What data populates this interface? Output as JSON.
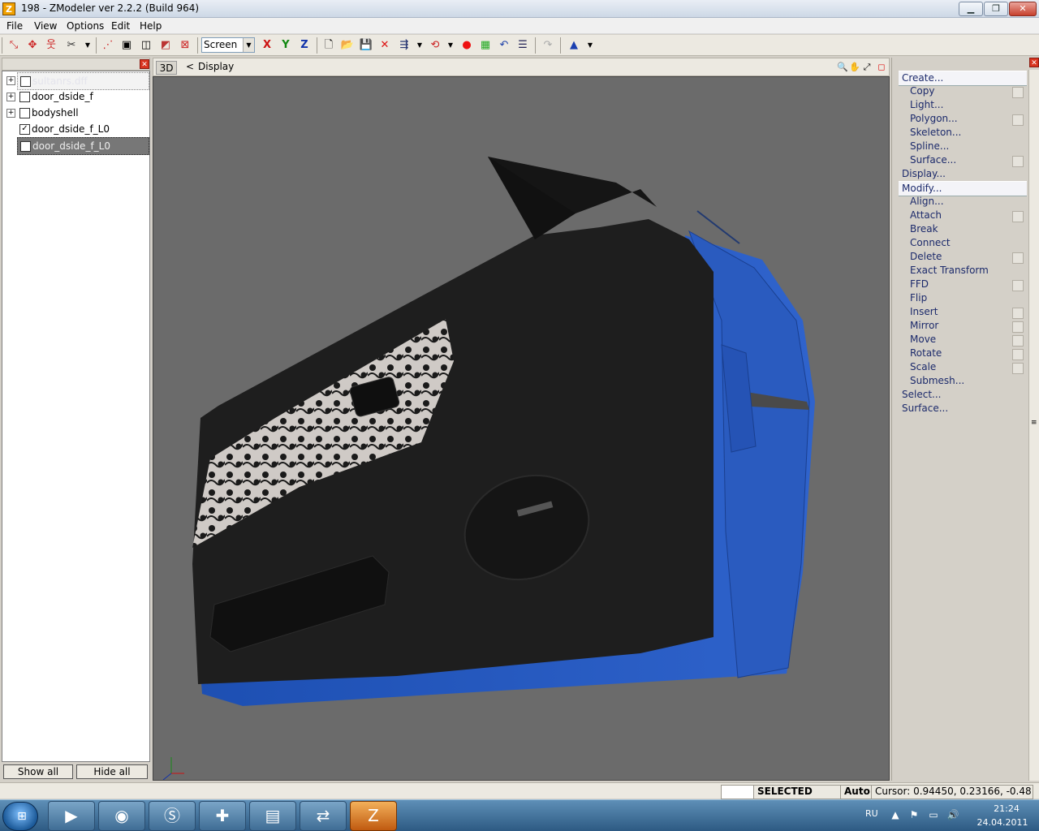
{
  "window": {
    "title": "198 - ZModeler ver 2.2.2 (Build 964)",
    "app_icon": "Z"
  },
  "menu": [
    "File",
    "View",
    "Options",
    "Edit",
    "Help"
  ],
  "toolbar": {
    "axis_labels": [
      "X",
      "Y",
      "Z"
    ],
    "coord_mode": "Screen",
    "icons": [
      "select-icon",
      "move-icon",
      "figure-icon",
      "options-icon",
      "cube-icon",
      "cube-wire-icon",
      "cube-front-icon",
      "cube-delete-icon",
      "new-file-icon",
      "open-folder-icon",
      "save-icon",
      "delete-icon",
      "import-icon",
      "undo-history-icon",
      "record-icon",
      "texture-icon",
      "undo-icon",
      "notes-icon",
      "redo-icon",
      "pyramid-icon"
    ]
  },
  "left_panel": {
    "tree": [
      {
        "label": "sultanrs.dff",
        "checked": false,
        "expandable": true
      },
      {
        "label": "door_dside_f",
        "checked": false,
        "expandable": true
      },
      {
        "label": "bodyshell",
        "checked": false,
        "expandable": true
      },
      {
        "label": "door_dside_f_L0",
        "checked": true,
        "expandable": false
      },
      {
        "label": "door_dside_f_L0",
        "checked": false,
        "expandable": false
      }
    ],
    "show_all": "Show all",
    "hide_all": "Hide all"
  },
  "viewport": {
    "tab": "3D",
    "back": "<",
    "title": "Display",
    "background": "#6b6b6b"
  },
  "commands": {
    "create": "Create...",
    "create_items": [
      "Copy",
      "Light...",
      "Polygon...",
      "Skeleton...",
      "Spline...",
      "Surface..."
    ],
    "display": "Display...",
    "modify": "Modify...",
    "modify_items": [
      "Align...",
      "Attach",
      "Break",
      "Connect",
      "Delete",
      "Exact Transform",
      "FFD",
      "Flip",
      "Insert",
      "Mirror",
      "Move",
      "Rotate",
      "Scale",
      "Submesh..."
    ],
    "select": "Select...",
    "surface": "Surface..."
  },
  "status": {
    "mode": "SELECTED MODE",
    "auto": "Auto",
    "cursor": "Cursor: 0.94450, 0.23166, -0.48"
  },
  "taskbar": {
    "apps": [
      "media-player-icon",
      "firefox-icon",
      "skype-icon",
      "tool-icon",
      "folder-icon",
      "teamviewer-icon",
      "zmodeler-icon"
    ],
    "lang": "RU",
    "time": "21:24",
    "date": "24.04.2011"
  },
  "colors": {
    "door_blue": "#2a5bbf",
    "door_panel": "#1e1e1e",
    "viewport_bg": "#6b6b6b"
  }
}
